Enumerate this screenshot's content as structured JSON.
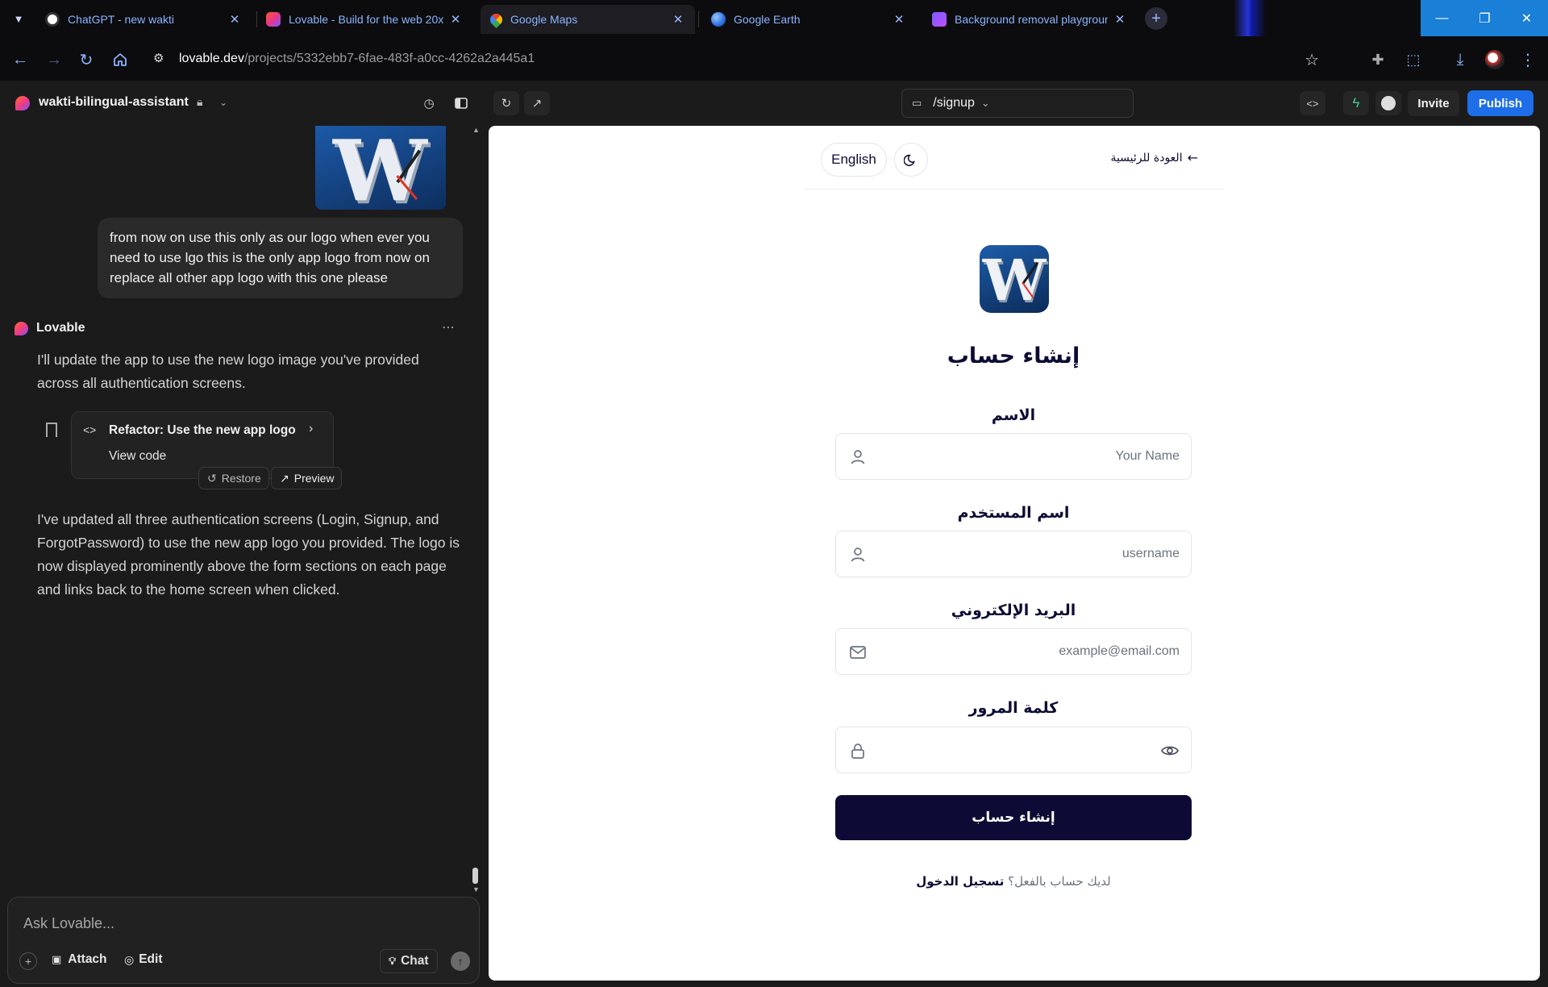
{
  "browser": {
    "tabs": [
      {
        "title": "ChatGPT - new wakti",
        "icon": "chatgpt-icon"
      },
      {
        "title": "Lovable - Build for the web 20x",
        "icon": "lovable-icon"
      },
      {
        "title": "Google Maps",
        "icon": "google-maps-icon"
      },
      {
        "title": "Google Earth",
        "icon": "google-earth-icon"
      },
      {
        "title": "Background removal playground",
        "icon": "bg-removal-icon"
      }
    ],
    "url_host": "lovable.dev",
    "url_path": "/projects/5332ebb7-6fae-483f-a0cc-4262a2a445a1"
  },
  "header": {
    "project_name": "wakti-bilingual-assistant",
    "route": "/signup",
    "invite_label": "Invite",
    "publish_label": "Publish"
  },
  "chat": {
    "user_message": "from now on use this only as our logo when ever you need to use lgo this is the only app logo from now on replace all other app logo with this one please",
    "assistant_name": "Lovable",
    "assistant_intro": "I'll update the app to use the new logo image you've provided across all authentication screens.",
    "refactor_title": "Refactor: Use the new app logo",
    "view_code_label": "View code",
    "restore_label": "Restore",
    "preview_label": "Preview",
    "assistant_summary": "I've updated all three authentication screens (Login, Signup, and ForgotPassword) to use the new app logo you provided. The logo is now displayed prominently above the form sections on each page and links back to the home screen when clicked.",
    "input_placeholder": "Ask Lovable...",
    "attach_label": "Attach",
    "edit_label": "Edit",
    "chat_label": "Chat"
  },
  "signup": {
    "language_label": "English",
    "back_home_label": "العودة للرئيسية",
    "title": "إنشاء حساب",
    "name_label": "الاسم",
    "name_placeholder": "Your Name",
    "username_label": "اسم المستخدم",
    "username_placeholder": "username",
    "email_label": "البريد الإلكتروني",
    "email_placeholder": "example@email.com",
    "password_label": "كلمة المرور",
    "submit_label": "إنشاء حساب",
    "have_account_text": "لديك حساب بالفعل؟",
    "login_link": "تسجيل الدخول",
    "logo_letter": "W"
  },
  "colors": {
    "accent_blue": "#1d6ee8",
    "primary_navy": "#0d0b35",
    "logo_blue": "#0e3d7a"
  }
}
